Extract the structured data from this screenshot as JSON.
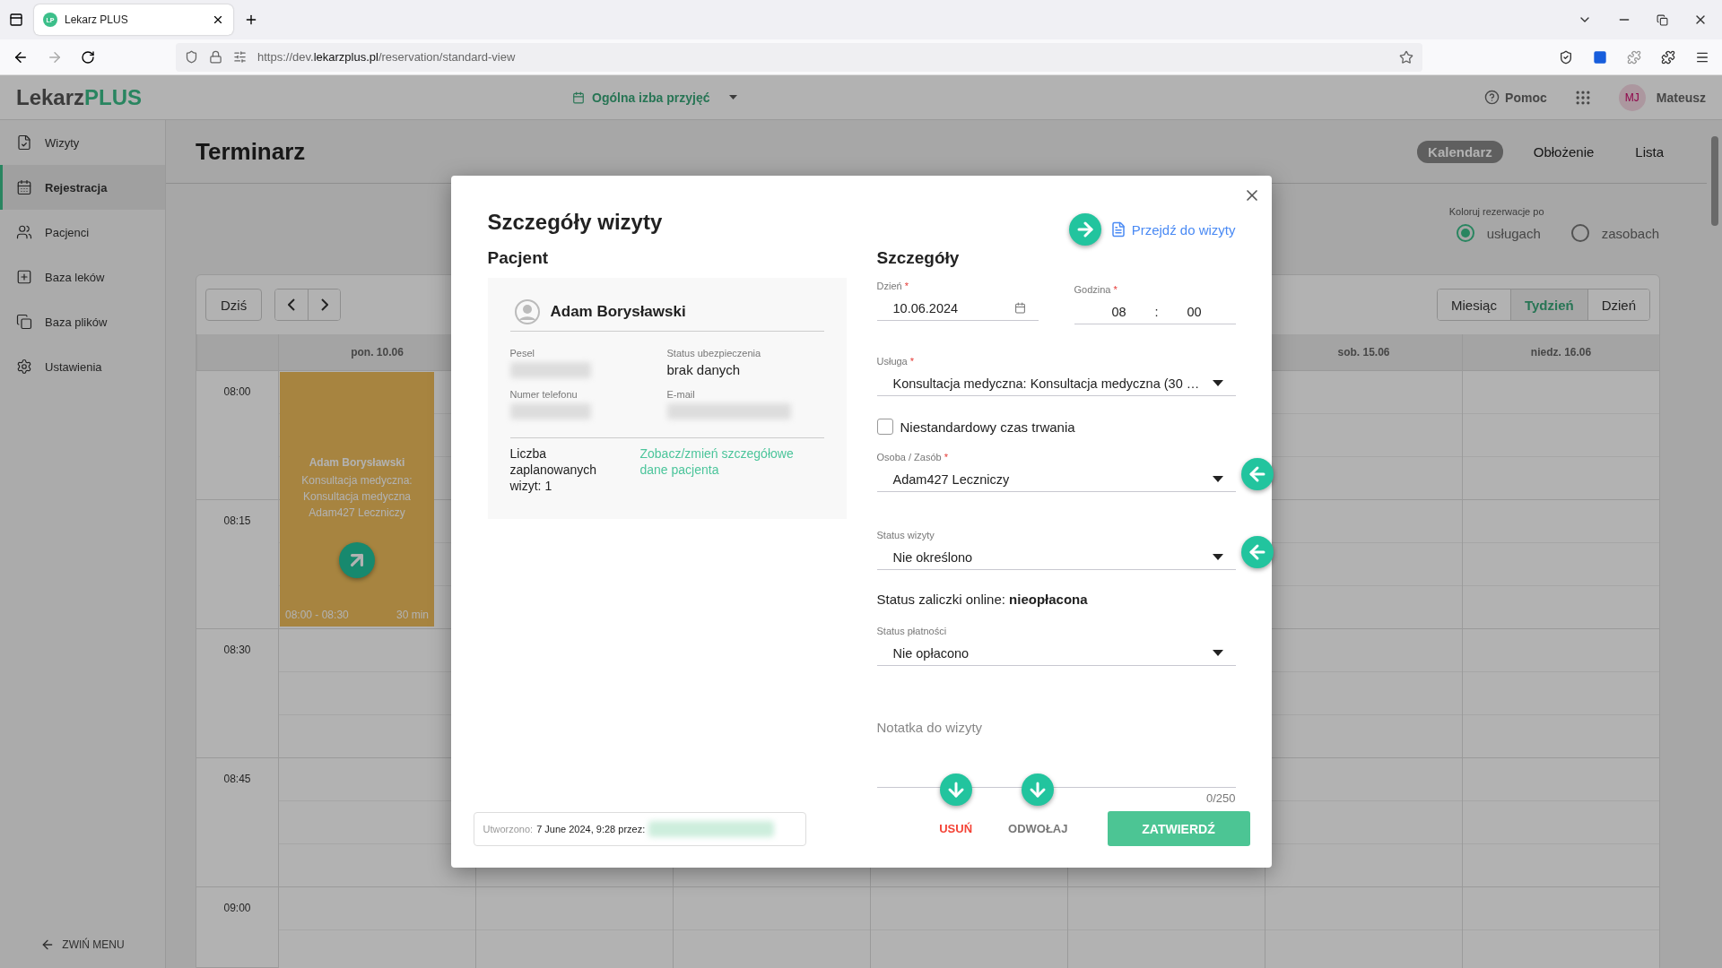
{
  "browser": {
    "tab_badge": "LP",
    "tab_title": "Lekarz PLUS",
    "url_prefix": "https://dev.",
    "url_domain": "lekarzplus.pl",
    "url_path": "/reservation/standard-view"
  },
  "header": {
    "logo_main": "Lekarz",
    "logo_accent": "PLUS",
    "location": "Ogólna izba przyjęć",
    "help": "Pomoc",
    "avatar": "MJ",
    "user": "Mateusz"
  },
  "sidebar": {
    "items": [
      {
        "label": "Wizyty",
        "selected": false
      },
      {
        "label": "Rejestracja",
        "selected": true
      },
      {
        "label": "Pacjenci",
        "selected": false
      },
      {
        "label": "Baza leków",
        "selected": false
      },
      {
        "label": "Baza plików",
        "selected": false
      },
      {
        "label": "Ustawienia",
        "selected": false
      }
    ],
    "collapse": "ZWIŃ MENU"
  },
  "page": {
    "title": "Terminarz",
    "views": [
      {
        "label": "Kalendarz",
        "selected": true
      },
      {
        "label": "Obłożenie",
        "selected": false
      },
      {
        "label": "Lista",
        "selected": false
      }
    ],
    "color_by": {
      "label": "Koloruj rezerwacje po",
      "options": [
        {
          "label": "usługach",
          "selected": true
        },
        {
          "label": "zasobach",
          "selected": false
        }
      ]
    }
  },
  "calendar": {
    "today": "Dziś",
    "ranges": [
      {
        "label": "Miesiąc",
        "selected": false
      },
      {
        "label": "Tydzień",
        "selected": true
      },
      {
        "label": "Dzień",
        "selected": false
      }
    ],
    "days": [
      {
        "label": "pon. 10.06"
      },
      {
        "label": "sob. 15.06"
      },
      {
        "label": "niedz. 16.06"
      }
    ],
    "times": [
      "08:00",
      "08:15",
      "08:30",
      "08:45",
      "09:00"
    ],
    "event": {
      "patient": "Adam Borysławski",
      "lines": [
        "Konsultacja medyczna:",
        "Konsultacja medyczna",
        "Adam427 Leczniczy"
      ],
      "range": "08:00 - 08:30",
      "duration": "30 min"
    }
  },
  "modal": {
    "title": "Szczegóły wizyty",
    "go_to_visit": "Przejdź do wizyty",
    "patient": {
      "heading": "Pacjent",
      "name": "Adam Borysławski",
      "fields": [
        {
          "label": "Pesel",
          "value_redacted": true
        },
        {
          "label": "Status ubezpieczenia",
          "value": "brak danych"
        },
        {
          "label": "Numer telefonu",
          "value_redacted": true
        },
        {
          "label": "E-mail",
          "value_redacted": true
        }
      ],
      "visit_count": "Liczba zaplanowanych wizyt: 1",
      "details_link": "Zobacz/zmień szczegółowe dane pacjenta"
    },
    "details": {
      "heading": "Szczegóły",
      "day": {
        "label": "Dzień",
        "required_mark": "*",
        "value": "10.06.2024"
      },
      "hour": {
        "label": "Godzina",
        "required_mark": "*",
        "hours": "08",
        "separator": ":",
        "minutes": "00"
      },
      "service": {
        "label": "Usługa",
        "required_mark": "*",
        "value": "Konsultacja medyczna: Konsultacja medyczna (30 …"
      },
      "custom_duration": {
        "label": "Niestandardowy czas trwania",
        "checked": false
      },
      "resource": {
        "label": "Osoba / Zasób",
        "required_mark": "*",
        "value": "Adam427 Leczniczy"
      },
      "visit_status": {
        "label": "Status wizyty",
        "value": "Nie określono"
      },
      "deposit_status": "Status zaliczki online: **nieopłacona**",
      "payment_status": {
        "label": "Status płatności",
        "value": "Nie opłacono"
      },
      "note": {
        "placeholder": "Notatka do wizyty",
        "counter": "0/250"
      }
    },
    "created": {
      "label": "Utworzono:",
      "value": "7 June 2024, 9:28 przez:"
    },
    "actions": {
      "delete": "USUŃ",
      "cancel": "ODWOŁAJ",
      "confirm": "ZATWIERDŹ"
    }
  }
}
